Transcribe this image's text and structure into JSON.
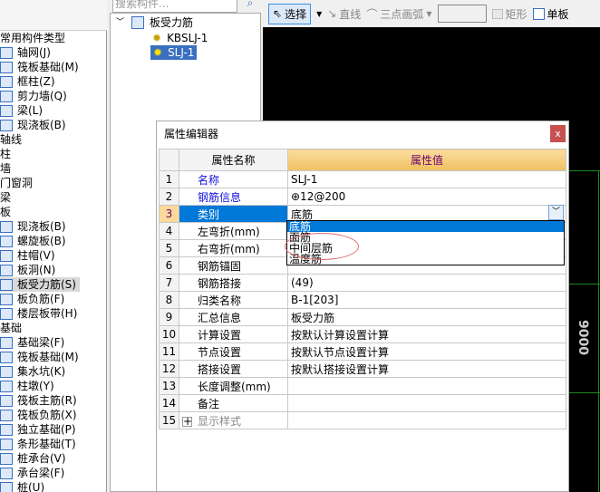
{
  "toolbar": {
    "select": "选择",
    "line": "直线",
    "arc": "三点画弧",
    "rect": "矩形",
    "single": "单板"
  },
  "tree": {
    "search_placeholder": "搜索构件...",
    "root": "板受力筋",
    "children": [
      "KBSLJ-1",
      "SLJ-1"
    ],
    "selected": "SLJ-1"
  },
  "left": {
    "items": [
      {
        "label": "常用构件类型",
        "cat": true
      },
      {
        "label": "轴网(J)"
      },
      {
        "label": "筏板基础(M)"
      },
      {
        "label": "框柱(Z)"
      },
      {
        "label": "剪力墙(Q)"
      },
      {
        "label": "梁(L)"
      },
      {
        "label": "现浇板(B)"
      },
      {
        "label": "轴线",
        "cat": true
      },
      {
        "label": "柱",
        "cat": true
      },
      {
        "label": "墙",
        "cat": true
      },
      {
        "label": "门窗洞",
        "cat": true
      },
      {
        "label": "梁",
        "cat": true
      },
      {
        "label": "板",
        "cat": true
      },
      {
        "label": "现浇板(B)"
      },
      {
        "label": "螺旋板(B)"
      },
      {
        "label": "柱帽(V)"
      },
      {
        "label": "板洞(N)"
      },
      {
        "label": "板受力筋(S)",
        "selected": true
      },
      {
        "label": "板负筋(F)"
      },
      {
        "label": "楼层板带(H)"
      },
      {
        "label": "基础",
        "cat": true
      },
      {
        "label": "基础梁(F)"
      },
      {
        "label": "筏板基础(M)"
      },
      {
        "label": "集水坑(K)"
      },
      {
        "label": "柱墩(Y)"
      },
      {
        "label": "筏板主筋(R)"
      },
      {
        "label": "筏板负筋(X)"
      },
      {
        "label": "独立基础(P)"
      },
      {
        "label": "条形基础(T)"
      },
      {
        "label": "桩承台(V)"
      },
      {
        "label": "承台梁(F)"
      },
      {
        "label": "桩(U)"
      }
    ]
  },
  "dialog": {
    "title": "属性编辑器",
    "close": "x",
    "col_name": "属性名称",
    "col_value": "属性值",
    "rows": [
      {
        "n": "1",
        "k": "名称",
        "v": "SLJ-1",
        "blue": true
      },
      {
        "n": "2",
        "k": "钢筋信息",
        "v": "⊕12@200",
        "blue": true
      },
      {
        "n": "3",
        "k": "类别",
        "v": "底筋",
        "selected": true
      },
      {
        "n": "4",
        "k": "左弯折(mm)",
        "v": ""
      },
      {
        "n": "5",
        "k": "右弯折(mm)",
        "v": ""
      },
      {
        "n": "6",
        "k": "钢筋锚固",
        "v": ""
      },
      {
        "n": "7",
        "k": "钢筋搭接",
        "v": "(49)"
      },
      {
        "n": "8",
        "k": "归类名称",
        "v": "B-1[203]"
      },
      {
        "n": "9",
        "k": "汇总信息",
        "v": "板受力筋"
      },
      {
        "n": "10",
        "k": "计算设置",
        "v": "按默认计算设置计算"
      },
      {
        "n": "11",
        "k": "节点设置",
        "v": "按默认节点设置计算"
      },
      {
        "n": "12",
        "k": "搭接设置",
        "v": "按默认搭接设置计算"
      },
      {
        "n": "13",
        "k": "长度调整(mm)",
        "v": ""
      },
      {
        "n": "14",
        "k": "备注",
        "v": ""
      },
      {
        "n": "15",
        "k": "显示样式",
        "v": "",
        "expand": "+"
      }
    ],
    "dropdown_options": [
      "底筋",
      "面筋",
      "中间层筋",
      "温度筋"
    ],
    "dropdown_selected": "底筋"
  },
  "canvas": {
    "dimension": "9000",
    "grid_color": "#1c8a1c"
  }
}
